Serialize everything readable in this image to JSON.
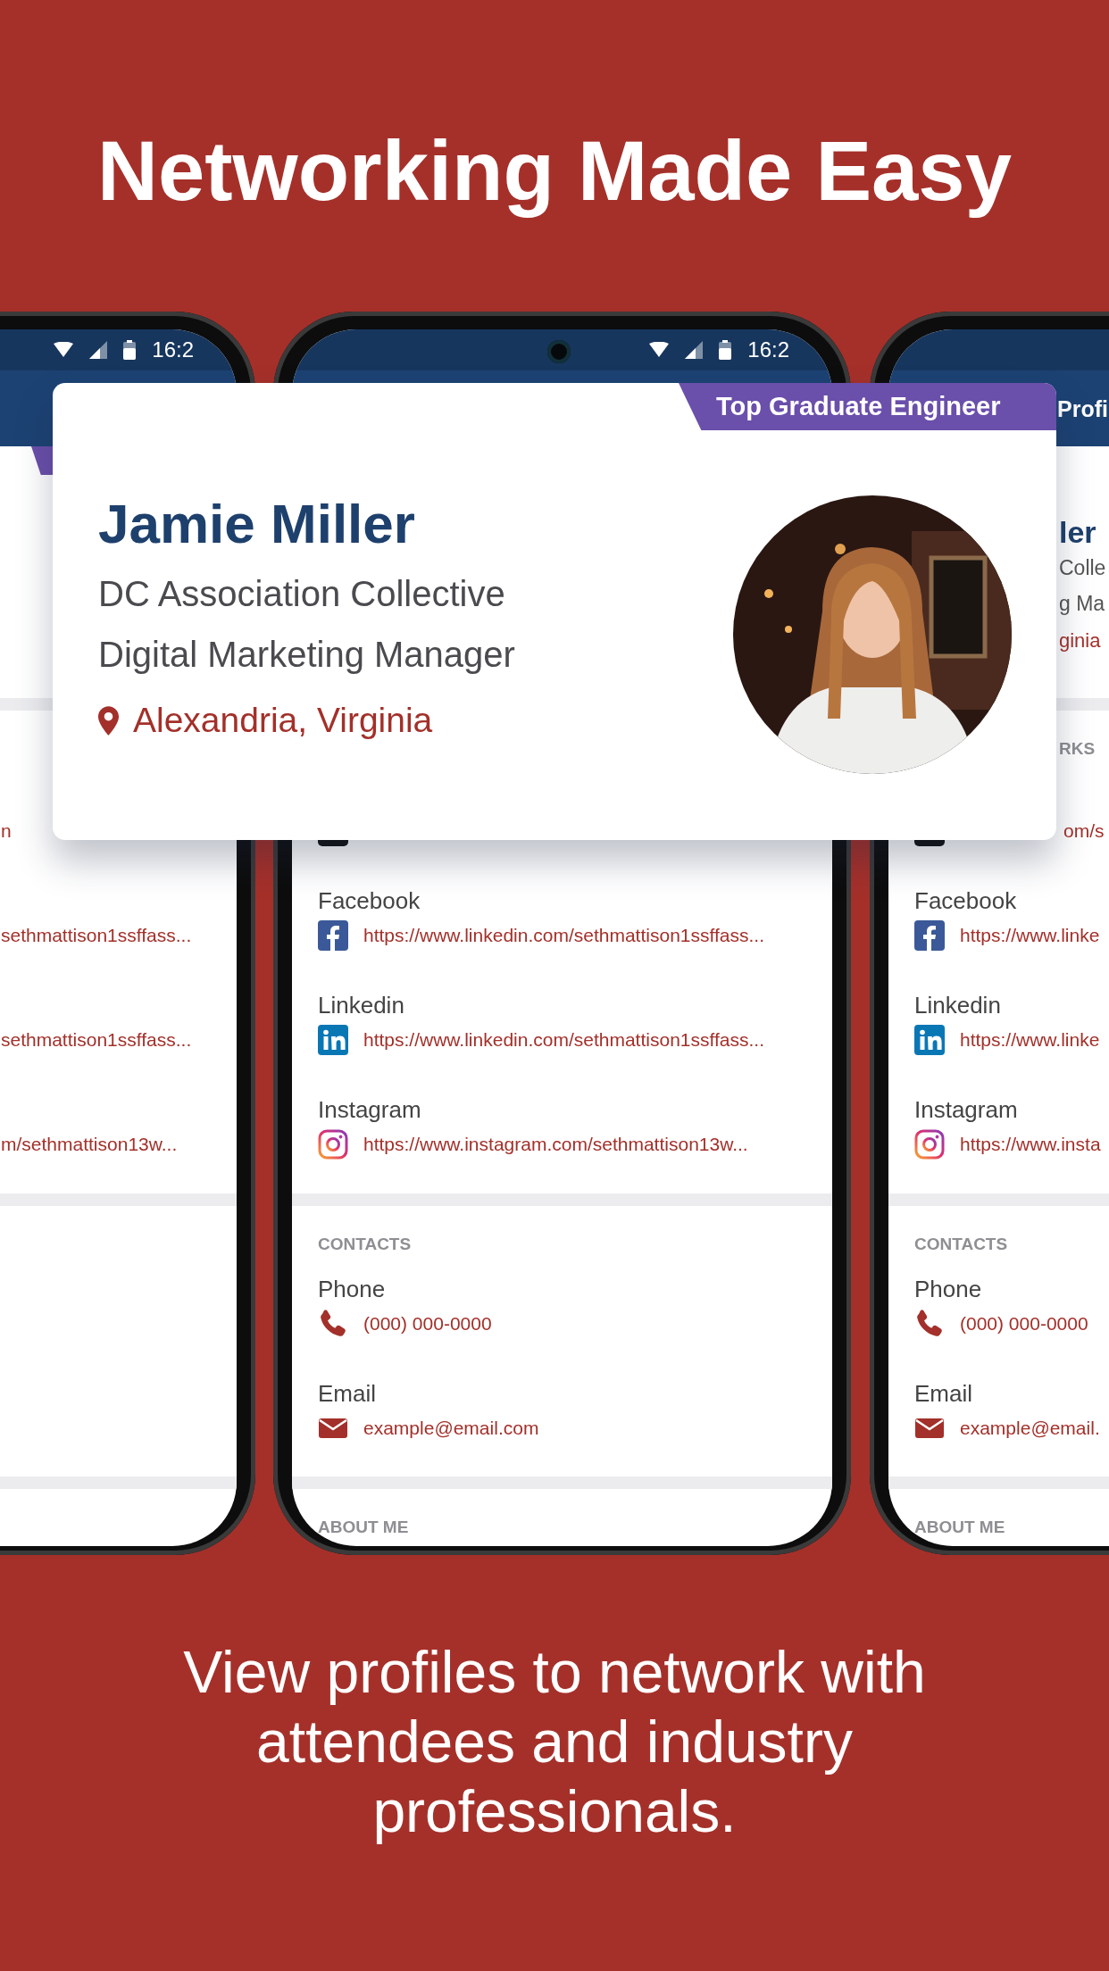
{
  "headline": "Networking Made Easy",
  "phones": [
    {
      "time": "16:2",
      "camera": false,
      "ribbon": true,
      "sections": [
        {
          "entries": [
            {
              "link": "n"
            },
            {
              "link": "sethmattison1ssffass..."
            },
            {
              "link": "sethmattison1ssffass..."
            },
            {
              "link": "m/sethmattison13w..."
            }
          ]
        }
      ]
    },
    {
      "time": "16:2",
      "camera": true,
      "ribbon": false,
      "sections": [
        {
          "entries": [
            {
              "kind": "social"
            },
            {
              "label": "Facebook",
              "kind": "facebook",
              "link": "https://www.linkedin.com/sethmattison1ssffass..."
            },
            {
              "label": "Linkedin",
              "kind": "linkedin",
              "link": "https://www.linkedin.com/sethmattison1ssffass..."
            },
            {
              "label": "Instagram",
              "kind": "instagram",
              "link": "https://www.instagram.com/sethmattison13w..."
            }
          ]
        },
        {
          "heading": "CONTACTS",
          "entries": [
            {
              "label": "Phone",
              "kind": "phone",
              "link": "(000) 000-0000"
            },
            {
              "label": "Email",
              "kind": "email",
              "link": "example@email.com"
            }
          ]
        },
        {
          "heading": "ABOUT ME"
        }
      ]
    },
    {
      "camera": false,
      "ribbon": false,
      "header_title": "Profi",
      "summary": {
        "name": "ler",
        "company": "Colle",
        "role": "g Ma",
        "location": "ginia"
      },
      "sections": [
        {
          "heading": "RKS",
          "entries": [
            {
              "kind": "social",
              "link": "om/s"
            },
            {
              "label": "Facebook",
              "kind": "facebook",
              "link": "https://www.linke"
            },
            {
              "label": "Linkedin",
              "kind": "linkedin",
              "link": "https://www.linke"
            },
            {
              "label": "Instagram",
              "kind": "instagram",
              "link": "https://www.insta"
            }
          ]
        },
        {
          "heading": "CONTACTS",
          "entries": [
            {
              "label": "Phone",
              "kind": "phone",
              "link": "(000) 000-0000"
            },
            {
              "label": "Email",
              "kind": "email",
              "link": "example@email."
            }
          ]
        },
        {
          "heading": "ABOUT ME"
        }
      ]
    }
  ],
  "card": {
    "badge": "Top Graduate Engineer",
    "name": "Jamie Miller",
    "company": "DC Association Collective",
    "role": "Digital Marketing Manager",
    "location": "Alexandria, Virginia"
  },
  "caption": "View profiles to network with attendees and industry professionals."
}
